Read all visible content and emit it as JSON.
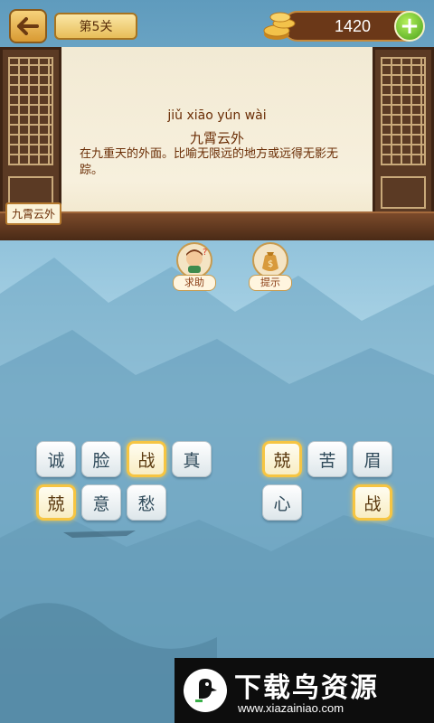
{
  "header": {
    "level_label": "第5关",
    "coins": "1420",
    "add_label": "+"
  },
  "stage": {
    "pinyin": "jiǔ xiāo yún wài",
    "idiom": "九霄云外",
    "definition": "在九重天的外面。比喻无限远的地方或远得无影无踪。",
    "solved_tag": "九霄云外"
  },
  "helpers": {
    "ask_label": "求助",
    "hint_label": "提示"
  },
  "tiles_left": [
    {
      "char": "诚",
      "lit": false
    },
    {
      "char": "脸",
      "lit": false
    },
    {
      "char": "战",
      "lit": true
    },
    {
      "char": "真",
      "lit": false
    },
    {
      "char": "兢",
      "lit": true
    },
    {
      "char": "意",
      "lit": false
    },
    {
      "char": "愁",
      "lit": false
    }
  ],
  "tiles_right": [
    {
      "char": "兢",
      "lit": true
    },
    {
      "char": "苦",
      "lit": false
    },
    {
      "char": "眉",
      "lit": false
    },
    {
      "char": "心",
      "lit": false
    },
    {
      "char": "战",
      "lit": true
    }
  ],
  "watermark": {
    "title": "下载鸟资源",
    "url": "www.xiazainiao.com"
  },
  "colors": {
    "tile_highlight": "#f6c542",
    "coin_bg": "#6b3818",
    "add_button": "#48a21c"
  }
}
